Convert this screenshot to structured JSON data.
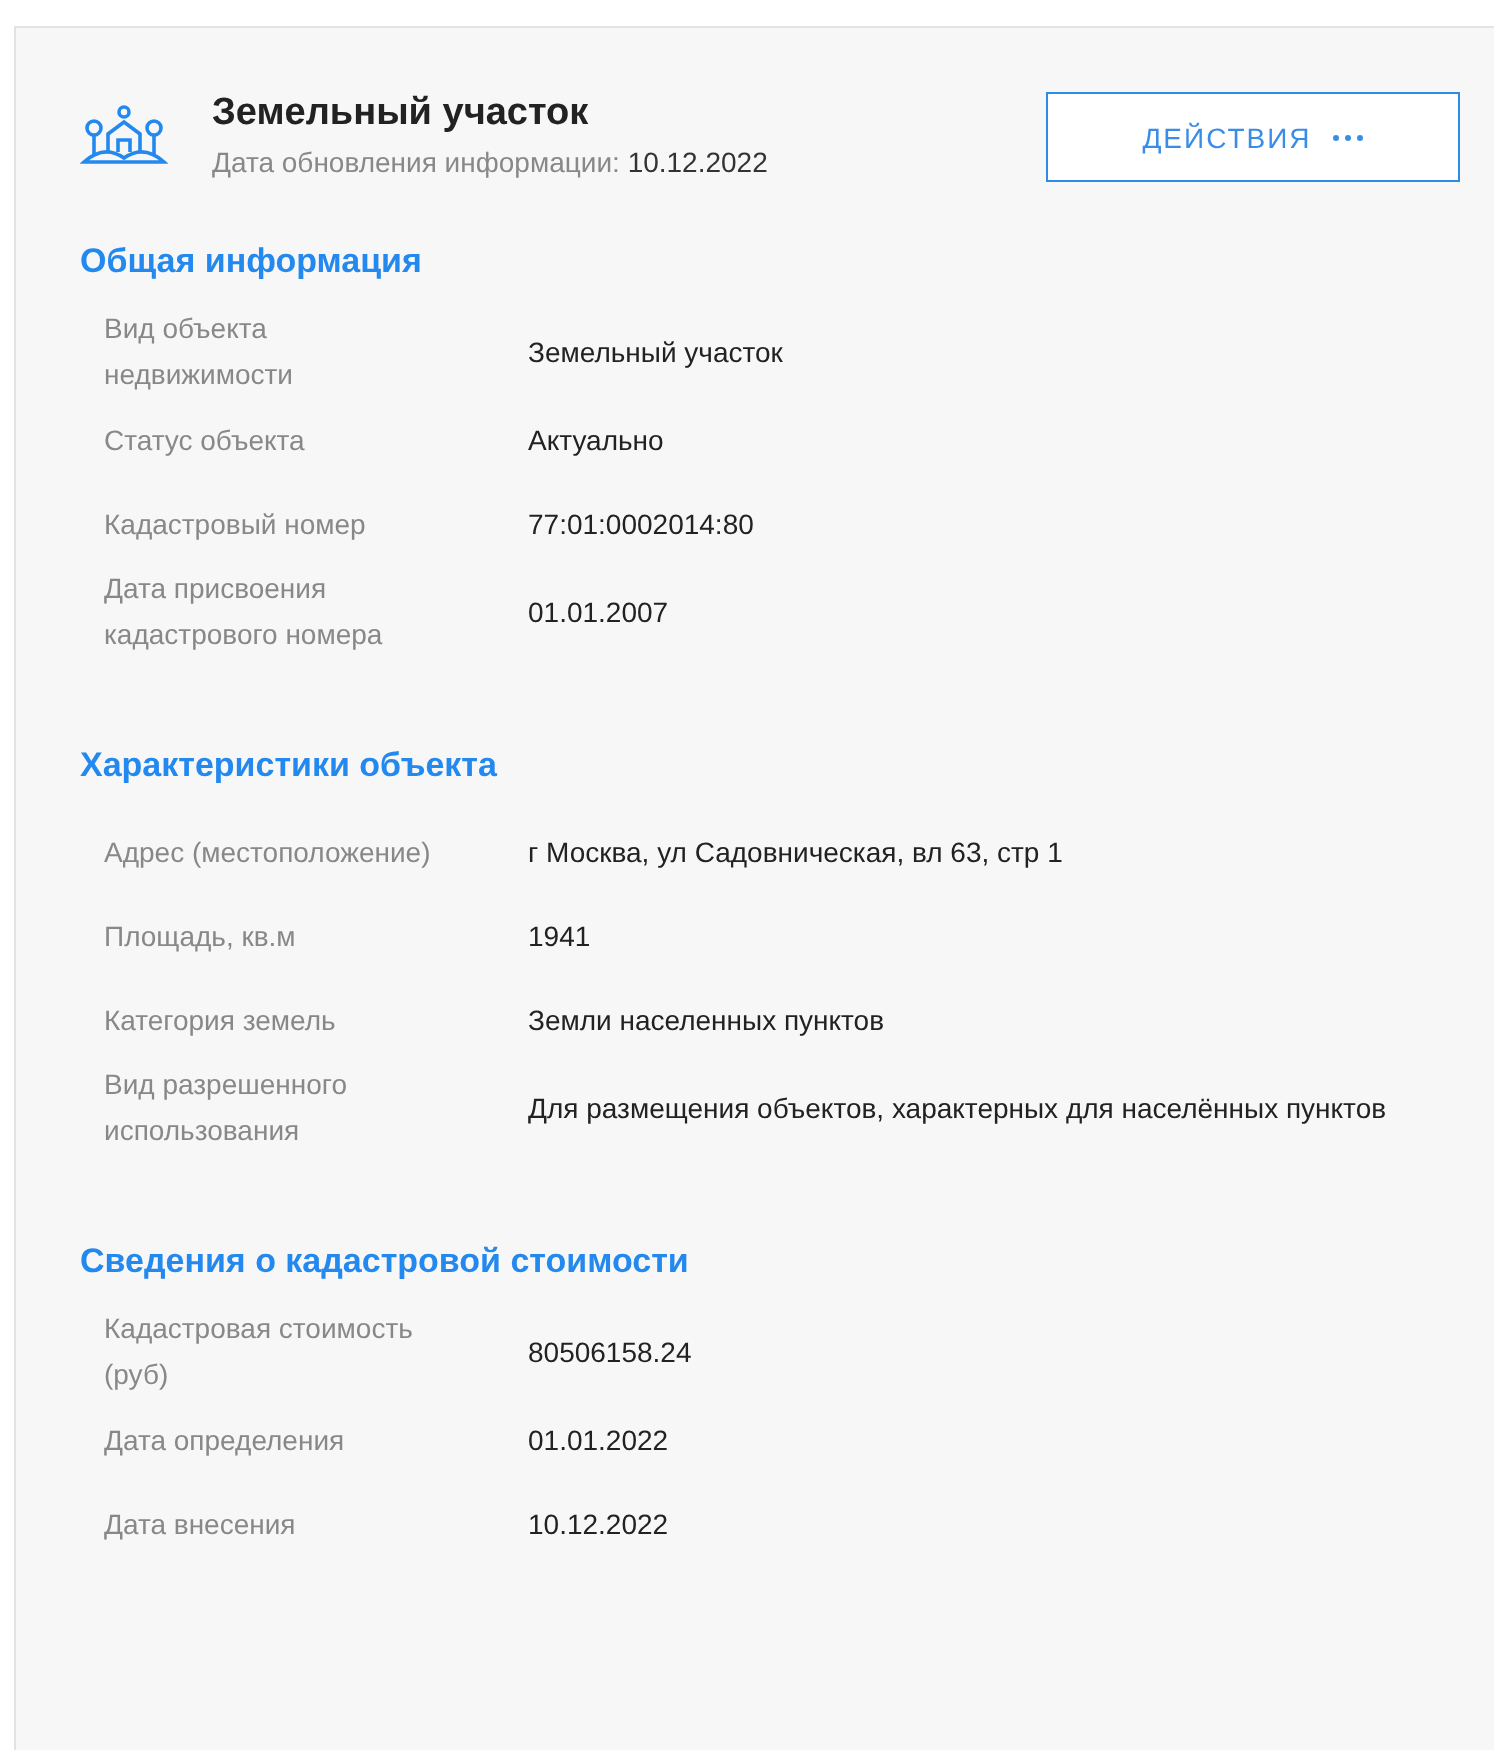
{
  "header": {
    "title": "Земельный участок",
    "updated_label": "Дата обновления информации:",
    "updated_date": "10.12.2022",
    "actions_button": "ДЕЙСТВИЯ"
  },
  "sections": [
    {
      "title": "Общая информация",
      "rows": [
        {
          "label": "Вид объекта недвижимости",
          "value": "Земельный участок"
        },
        {
          "label": "Статус объекта",
          "value": "Актуально"
        },
        {
          "label": "Кадастровый номер",
          "value": "77:01:0002014:80"
        },
        {
          "label": "Дата присвоения кадастрового номера",
          "value": "01.01.2007"
        }
      ]
    },
    {
      "title": "Характеристики объекта",
      "rows": [
        {
          "label": "Адрес (местоположение)",
          "value": "г Москва, ул Садовническая, вл 63, стр 1"
        },
        {
          "label": "Площадь, кв.м",
          "value": "1941"
        },
        {
          "label": "Категория земель",
          "value": "Земли населенных пунктов"
        },
        {
          "label": "Вид разрешенного использования",
          "value": "Для размещения объектов, характерных для населённых пунктов"
        }
      ]
    },
    {
      "title": "Сведения о кадастровой стоимости",
      "rows": [
        {
          "label": "Кадастровая стоимость (руб)",
          "value": "80506158.24"
        },
        {
          "label": "Дата определения",
          "value": "01.01.2022"
        },
        {
          "label": "Дата внесения",
          "value": "10.12.2022"
        }
      ]
    }
  ]
}
